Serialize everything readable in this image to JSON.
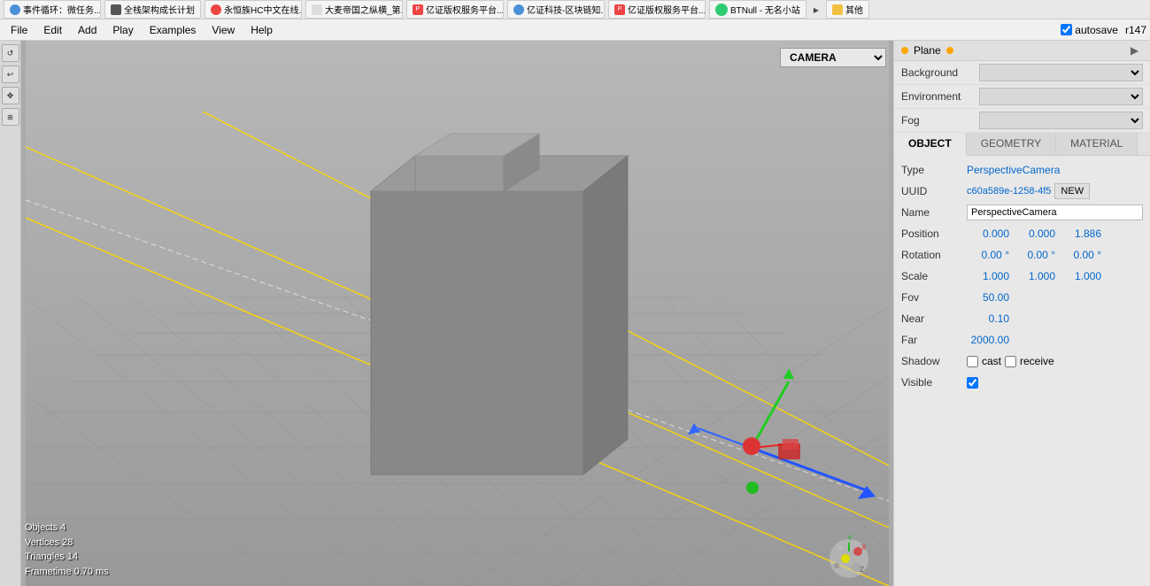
{
  "browser": {
    "tabs": [
      {
        "label": "事件循环：微任务...",
        "icon": "favicon"
      },
      {
        "label": "全栈架构成长计划",
        "icon": "favicon"
      },
      {
        "label": "永恒族HC中文在线...",
        "icon": "red-icon"
      },
      {
        "label": "大麦帝国之纵横_第...",
        "icon": "doc-icon"
      },
      {
        "label": "亿证版权服务平台...",
        "icon": "pdf-icon"
      },
      {
        "label": "亿证科技-区块链知...",
        "icon": "diamond-icon"
      },
      {
        "label": "亿证版权服务平台...",
        "icon": "pdf-icon"
      },
      {
        "label": "BTNull - 无名小站",
        "icon": "btn-icon"
      },
      {
        "label": "其他",
        "icon": "folder-icon"
      }
    ]
  },
  "menubar": {
    "items": [
      "File",
      "Edit",
      "Add",
      "Play",
      "Examples",
      "View",
      "Help"
    ],
    "autosave_label": "autosave",
    "revision_label": "r147"
  },
  "toolbar": {
    "tools": [
      "↺",
      "↩",
      "✥",
      "⊞"
    ]
  },
  "viewport": {
    "camera_options": [
      "CAMERA"
    ],
    "camera_selected": "CAMERA",
    "stats": {
      "objects": "Objects  4",
      "vertices": "Vertices  28",
      "triangles": "Triangles  14",
      "frametime": "Frametime  0.70 ms"
    }
  },
  "panel": {
    "scene_label": "Plane",
    "bg_label": "Background",
    "env_label": "Environment",
    "fog_label": "Fog",
    "tabs": [
      "OBJECT",
      "GEOMETRY",
      "MATERIAL"
    ],
    "active_tab": "OBJECT",
    "properties": {
      "type_label": "Type",
      "type_value": "PerspectiveCamera",
      "uuid_label": "UUID",
      "uuid_value": "c60a589e-1258-4f5",
      "uuid_btn": "NEW",
      "name_label": "Name",
      "name_value": "PerspectiveCamera",
      "position_label": "Position",
      "position_x": "0.000",
      "position_y": "0.000",
      "position_z": "1.886",
      "rotation_label": "Rotation",
      "rotation_x": "0.00 °",
      "rotation_y": "0.00 °",
      "rotation_z": "0.00 °",
      "scale_label": "Scale",
      "scale_x": "1.000",
      "scale_y": "1.000",
      "scale_z": "1.000",
      "fov_label": "Fov",
      "fov_value": "50.00",
      "near_label": "Near",
      "near_value": "0.10",
      "far_label": "Far",
      "far_value": "2000.00",
      "shadow_label": "Shadow",
      "shadow_cast": "cast",
      "shadow_receive": "receive",
      "visible_label": "Visible"
    }
  }
}
